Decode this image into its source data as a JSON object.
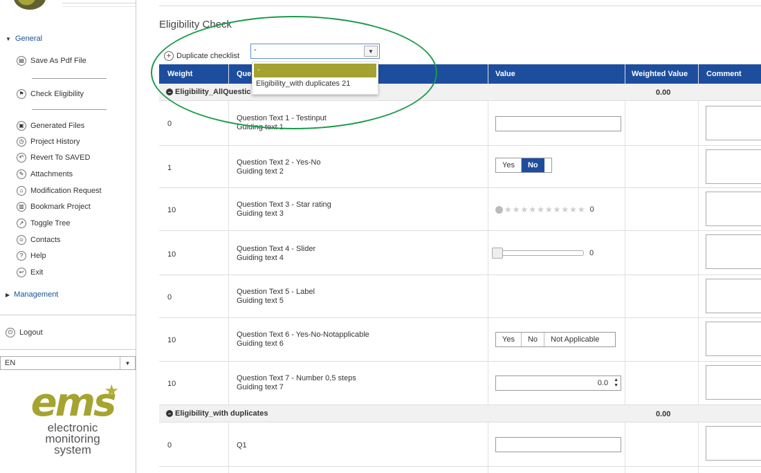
{
  "sidebar": {
    "sections": {
      "general": "General",
      "management": "Management"
    },
    "items": [
      {
        "label": "Save As Pdf File",
        "icon": "save-icon"
      },
      {
        "label": "Check Eligibility",
        "icon": "flag-icon"
      },
      {
        "label": "Generated Files",
        "icon": "file-icon"
      },
      {
        "label": "Project History",
        "icon": "history-icon"
      },
      {
        "label": "Revert To SAVED",
        "icon": "revert-icon"
      },
      {
        "label": "Attachments",
        "icon": "paperclip-icon"
      },
      {
        "label": "Modification Request",
        "icon": "bank-icon"
      },
      {
        "label": "Bookmark Project",
        "icon": "bookmark-icon"
      },
      {
        "label": "Toggle Tree",
        "icon": "tree-icon"
      },
      {
        "label": "Contacts",
        "icon": "contact-icon"
      },
      {
        "label": "Help",
        "icon": "help-icon"
      },
      {
        "label": "Exit",
        "icon": "exit-icon"
      }
    ],
    "logout": "Logout",
    "language": "EN",
    "logo": {
      "word": "ems",
      "line1": "electronic",
      "line2": "monitoring",
      "line3": "system"
    }
  },
  "main": {
    "title": "Eligibility Check",
    "duplicate_label": "Duplicate checklist",
    "duplicate_value": "-",
    "dropdown_options": [
      "-",
      "Eligibility_with duplicates 21"
    ],
    "columns": [
      "Weight",
      "Que",
      "Value",
      "Weighted Value",
      "Comment"
    ],
    "groups": [
      {
        "label": "Eligibility_AllQuestic",
        "value": "0.00"
      },
      {
        "label": "Eligibility_with duplicates",
        "value": "0.00"
      }
    ],
    "rows": [
      {
        "weight": "0",
        "q": "Question Text 1 - Testinput",
        "g": "Guiding text 1"
      },
      {
        "weight": "1",
        "q": "Question Text 2 - Yes-No",
        "g": "Guiding text 2",
        "yes": "Yes",
        "no": "No"
      },
      {
        "weight": "10",
        "q": "Question Text 3 - Star rating",
        "g": "Guiding text 3",
        "val": "0"
      },
      {
        "weight": "10",
        "q": "Question Text 4 - Slider",
        "g": "Guiding text 4",
        "val": "0"
      },
      {
        "weight": "0",
        "q": "Question Text 5 - Label",
        "g": "Guiding text 5"
      },
      {
        "weight": "10",
        "q": "Question Text 6 - Yes-No-Notapplicable",
        "g": "Guiding text 6",
        "yes": "Yes",
        "no": "No",
        "na": "Not Applicable"
      },
      {
        "weight": "10",
        "q": "Question Text 7 - Number 0,5 steps",
        "g": "Guiding text 7",
        "val": "0.0"
      },
      {
        "weight": "0",
        "q": "Q1",
        "g": ""
      }
    ]
  },
  "colors": {
    "header_blue": "#1d4e9e",
    "accent_olive": "#a4a230",
    "annotation_green": "#1a9a4a"
  }
}
